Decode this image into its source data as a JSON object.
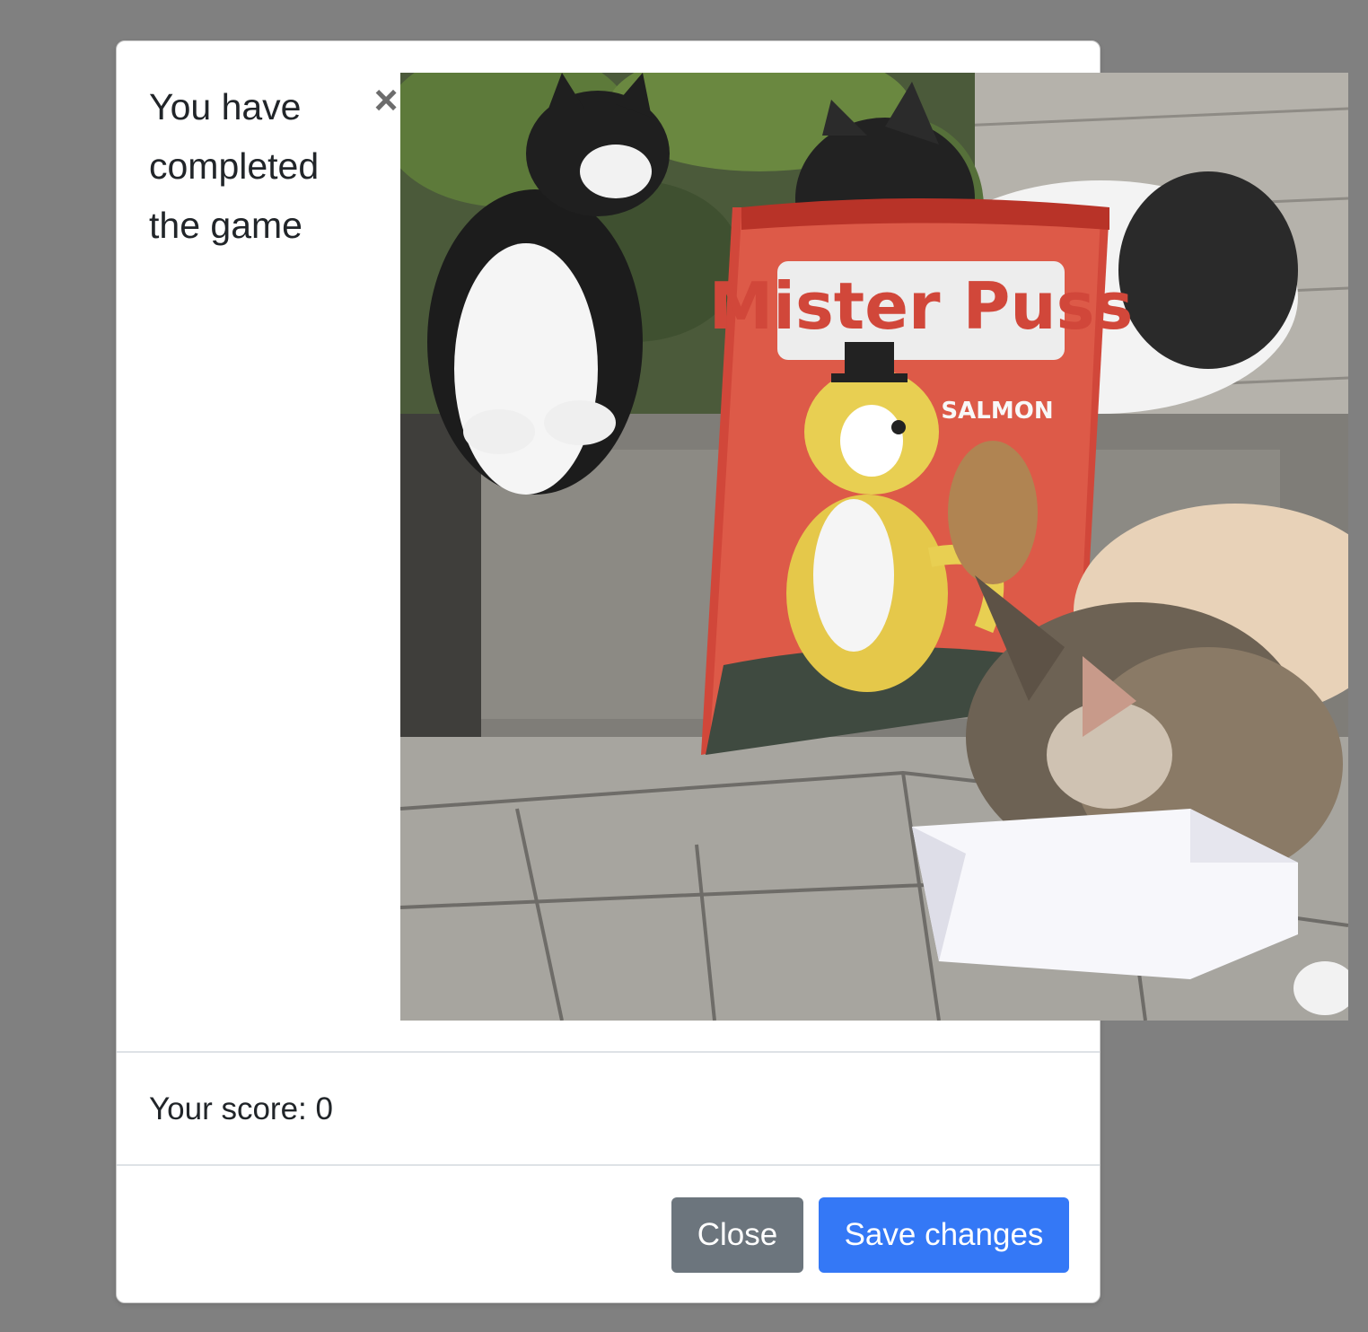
{
  "modal": {
    "title": "You have completed the game",
    "close_symbol": "×",
    "score_text": "Your score: 0",
    "buttons": {
      "close_label": "Close",
      "save_label": "Save changes"
    }
  },
  "image": {
    "subject": "kittens-with-cat-food-bag-photo",
    "bag_brand": "Mister Puss",
    "bag_flavor": "SALMON"
  },
  "colors": {
    "backdrop": "#808080",
    "secondary_button": "#6c757d",
    "primary_button": "#3478f6"
  }
}
